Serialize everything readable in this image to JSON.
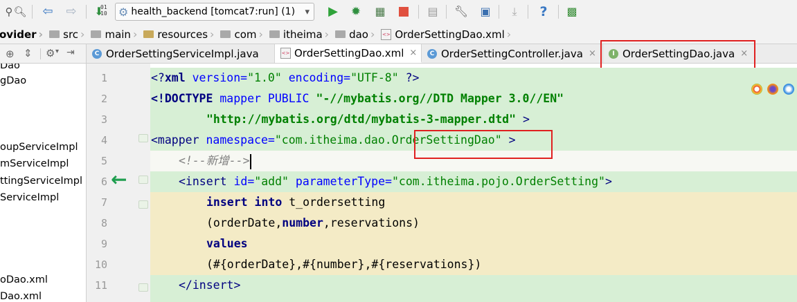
{
  "toolbar": {
    "run_config": "health_backend [tomcat7:run] (1)",
    "run_config_arrow": "▾",
    "counter_text": "01\n10",
    "icons": [
      "vcs-icon",
      "search-icon",
      "back-icon",
      "forward-icon",
      "build-icon",
      "run-config-icon",
      "run-icon",
      "debug-icon",
      "coverage-icon",
      "stop-icon",
      "attach-icon",
      "settings-icon",
      "project-structure-icon",
      "download-icon",
      "help-icon",
      "plugin-icon"
    ]
  },
  "breadcrumb": {
    "items": [
      "ovider",
      "src",
      "main",
      "resources",
      "com",
      "itheima",
      "dao",
      "OrderSettingDao.xml"
    ]
  },
  "tabs": [
    {
      "label": "OrderSettingServiceImpl.java",
      "icon": "C",
      "active": false
    },
    {
      "label": "OrderSettingDao.xml",
      "icon": "xml",
      "active": true
    },
    {
      "label": "OrderSettingController.java",
      "icon": "C",
      "active": false
    },
    {
      "label": "OrderSettingDao.java",
      "icon": "I",
      "active": false
    }
  ],
  "tab_close": "×",
  "project_tree": [
    "Dao",
    "gDao",
    "oupServiceImpl",
    "mServiceImpl",
    "ttingServiceImpl",
    "ServiceImpl",
    "oDao.xml",
    "Dao.xml"
  ],
  "editor": {
    "line_numbers": [
      "1",
      "2",
      "3",
      "4",
      "5",
      "6",
      "7",
      "8",
      "9",
      "10",
      "11"
    ],
    "lines": {
      "l1": {
        "a": "<?",
        "b": "xml ",
        "c": "version=",
        "d": "\"1.0\"",
        "e": " encoding=",
        "f": "\"UTF-8\"",
        "g": " ?>"
      },
      "l2": {
        "a": "<!DOCTYPE ",
        "b": "mapper ",
        "c": "PUBLIC ",
        "d": "\"-//mybatis.org//DTD Mapper 3.0//EN\""
      },
      "l3": {
        "a": "\"http://mybatis.org/dtd/mybatis-3-mapper.dtd\"",
        "b": " >"
      },
      "l4": {
        "a": "<mapper ",
        "b": "namespace=",
        "c": "\"com.itheima.dao.",
        "d": "OrderSettingDao",
        "e": "\"",
        "f": " >"
      },
      "l5": {
        "a": "<!--新增-->"
      },
      "l6": {
        "a": "<insert ",
        "b": "id=",
        "c": "\"add\"",
        "d": " parameterType=",
        "e": "\"com.itheima.pojo.OrderSetting\"",
        "f": ">"
      },
      "l7": {
        "a": "insert into ",
        "b": "t_ordersetting"
      },
      "l8": {
        "a": "(orderDate,",
        "b": "number",
        ",c": ",",
        "d": "reservations)"
      },
      "l9": {
        "a": "values"
      },
      "l10": {
        "a": "(#{orderDate},#{number},#{reservations})"
      },
      "l11": {
        "a": "</insert>"
      }
    }
  },
  "colors": {
    "green_band": "#d7efd5",
    "yellow_band": "#f4ebc6",
    "highlight_box": "#e02020",
    "arrow": "#1f9e4f"
  }
}
